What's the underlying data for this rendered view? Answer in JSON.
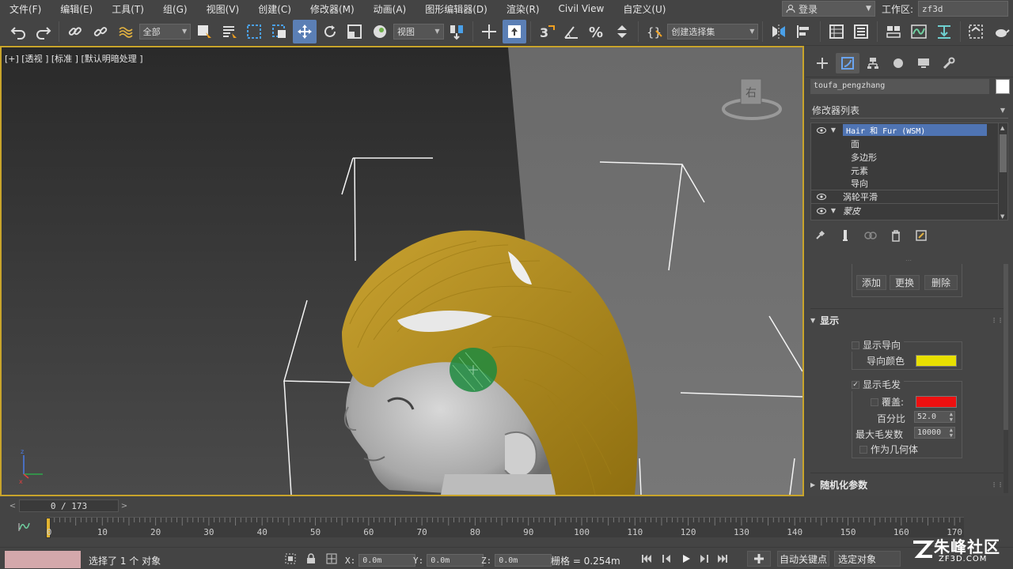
{
  "menu": [
    "文件(F)",
    "编辑(E)",
    "工具(T)",
    "组(G)",
    "视图(V)",
    "创建(C)",
    "修改器(M)",
    "动画(A)",
    "图形编辑器(D)",
    "渲染(R)",
    "Civil View",
    "自定义(U)"
  ],
  "header": {
    "login_label": "登录",
    "workspace_label": "工作区:",
    "workspace_value": "zf3d"
  },
  "toolbar": {
    "filter_dropdown": "全部",
    "coord_dropdown": "视图",
    "selection_set_dropdown": "创建选择集"
  },
  "viewport": {
    "label": "[+] [透视 ] [标准 ] [默认明暗处理 ]",
    "viewcube_label": "右"
  },
  "command_panel": {
    "object_name": "toufa_pengzhang",
    "modifier_list_label": "修改器列表",
    "stack": [
      {
        "label": "Hair 和 Fur (WSM)",
        "selected": true,
        "eye": true,
        "expand": true
      },
      {
        "label": "面",
        "sub": true
      },
      {
        "label": "多边形",
        "sub": true
      },
      {
        "label": "元素",
        "sub": true
      },
      {
        "label": "导向",
        "sub": true
      },
      {
        "label": "涡轮平滑",
        "eye": true
      },
      {
        "label": "蒙皮",
        "eye": true,
        "expand": true,
        "italic": true
      }
    ],
    "buttons": {
      "add": "添加",
      "replace": "更换",
      "delete": "删除"
    },
    "display_rollout": {
      "title": "显示",
      "show_guides": "显示导向",
      "guide_color_label": "导向颜色",
      "guide_color": "#e8e000",
      "show_hair": "显示毛发",
      "override_label": "覆盖:",
      "override_color": "#ee1010",
      "percent_label": "百分比",
      "percent_value": "52.0",
      "max_hairs_label": "最大毛发数",
      "max_hairs_value": "10000",
      "as_geometry": "作为几何体"
    },
    "random_rollout_title": "随机化参数"
  },
  "timeline": {
    "current_frame": "0",
    "total_frames": "173",
    "frame_display": "0 / 173",
    "ticks": [
      "0",
      "10",
      "20",
      "30",
      "40",
      "50",
      "60",
      "70",
      "80",
      "90",
      "100",
      "110",
      "120",
      "130",
      "140",
      "150",
      "160",
      "170"
    ]
  },
  "status": {
    "message": "选择了 1 个 对象",
    "x_label": "X:",
    "x_value": "0.0m",
    "y_label": "Y:",
    "y_value": "0.0m",
    "z_label": "Z:",
    "z_value": "0.0m",
    "grid_label": "栅格 = 0.254m",
    "auto_key": "自动关键点",
    "selected_object": "选定对象"
  },
  "watermark": {
    "text": "朱峰社区",
    "url": "ZF3D.COM"
  },
  "colors": {
    "hair": "#b48e1c",
    "selection_border": "#c8a42b",
    "accent_blue": "#5b7fb5"
  }
}
